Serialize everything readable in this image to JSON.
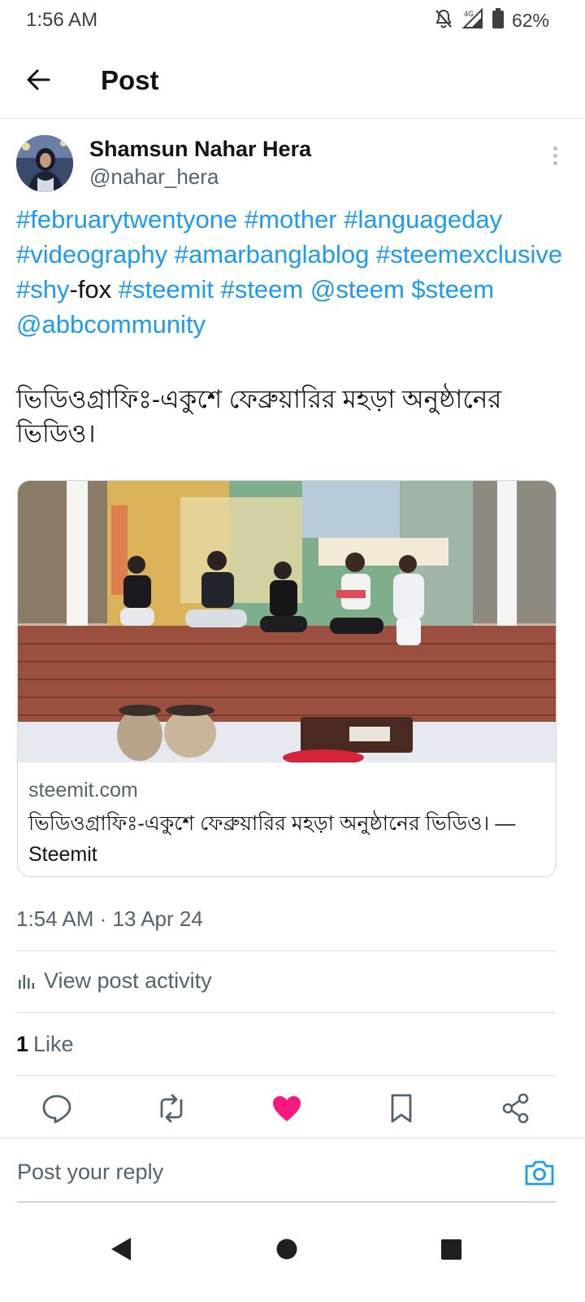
{
  "status_bar": {
    "time": "1:56 AM",
    "network": "4G",
    "battery": "62%",
    "icons": [
      "mute-icon",
      "signal-icon",
      "battery-icon"
    ]
  },
  "header": {
    "title": "Post",
    "back_icon": "arrow-left-icon"
  },
  "author": {
    "name": "Shamsun Nahar Hera",
    "handle": "@nahar_hera",
    "more_icon": "more-vertical-icon"
  },
  "post": {
    "segments": [
      {
        "text": "#februarytwentyone",
        "tag": true
      },
      {
        "text": " ",
        "tag": false
      },
      {
        "text": "#mother",
        "tag": true
      },
      {
        "text": "  ",
        "tag": false
      },
      {
        "text": "#languageday",
        "tag": true
      },
      {
        "text": " ",
        "tag": false
      },
      {
        "text": "#videography",
        "tag": true
      },
      {
        "text": " ",
        "tag": false
      },
      {
        "text": "#amarbanglablog",
        "tag": true
      },
      {
        "text": " ",
        "tag": false
      },
      {
        "text": "#steemexclusive",
        "tag": true
      },
      {
        "text": " ",
        "tag": false
      },
      {
        "text": "#shy",
        "tag": true
      },
      {
        "text": "-fox ",
        "tag": false
      },
      {
        "text": "#steemit",
        "tag": true
      },
      {
        "text": " ",
        "tag": false
      },
      {
        "text": "#steem",
        "tag": true
      },
      {
        "text": " ",
        "tag": false
      },
      {
        "text": "@steem",
        "tag": true
      },
      {
        "text": " ",
        "tag": false
      },
      {
        "text": "$steem",
        "tag": true
      },
      {
        "text": " ",
        "tag": false
      },
      {
        "text": "@abbcommunity",
        "tag": true
      }
    ],
    "bengali_text": "ভিডিওগ্রাফিঃ-একুশে ফেব্রুয়ারির মহড়া অনুষ্ঠানের ভিডিও।"
  },
  "card": {
    "domain": "steemit.com",
    "title": "ভিডিওগ্রাফিঃ-একুশে ফেব্রুয়ারির মহড়া অনুষ্ঠানের ভিডিও। — Steemit",
    "image_desc": "children-performing-on-stage-photo"
  },
  "meta": {
    "timestamp": "1:54 AM · 13 Apr 24",
    "activity_label": "View post activity",
    "like_count": "1",
    "like_label": "Like"
  },
  "actions": [
    "reply-icon",
    "repost-icon",
    "like-icon",
    "bookmark-icon",
    "share-icon"
  ],
  "reply": {
    "placeholder": "Post your reply"
  },
  "colors": {
    "link": "#1d9bf0",
    "like": "#f91880",
    "text": "#0f1419",
    "muted": "#536471"
  }
}
